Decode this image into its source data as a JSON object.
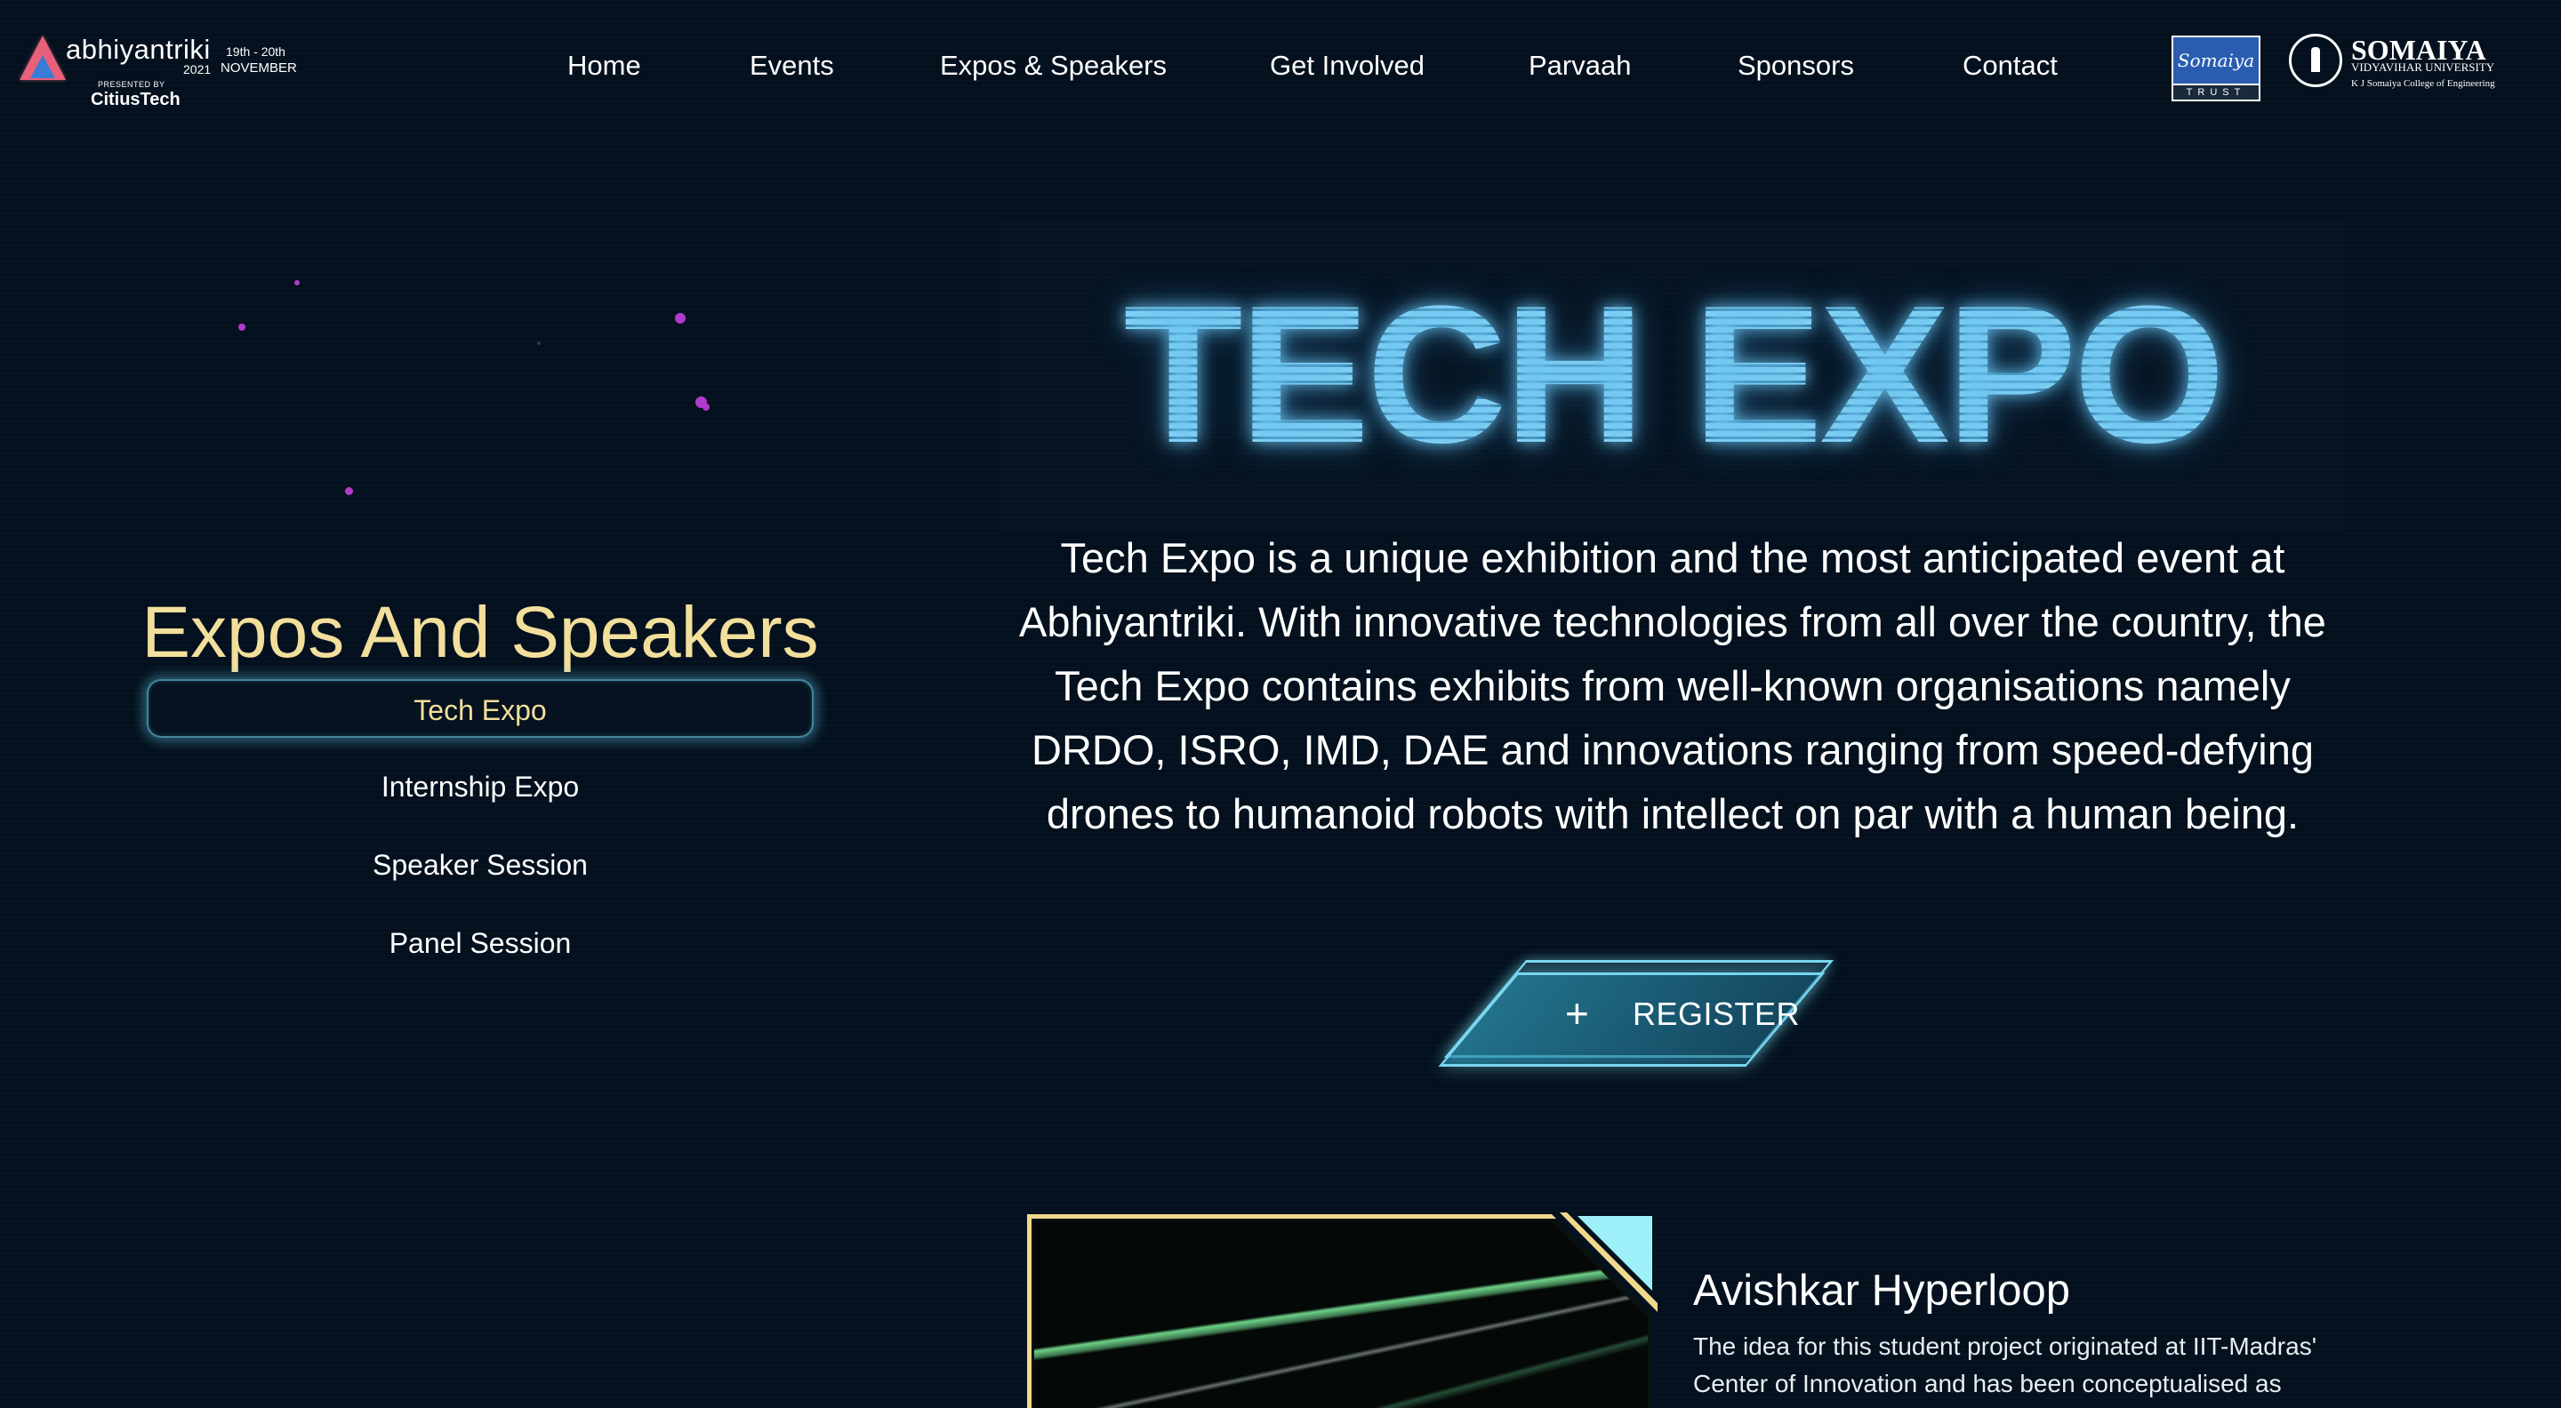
{
  "header": {
    "logo": {
      "name": "abhiyantriki",
      "year": "2021",
      "date_top": "19th - 20th",
      "date_bottom": "NOVEMBER",
      "presented_by": "PRESENTED BY",
      "sponsor": "CitiusTech"
    },
    "nav": [
      {
        "label": "Home"
      },
      {
        "label": "Events"
      },
      {
        "label": "Expos & Speakers"
      },
      {
        "label": "Get Involved"
      },
      {
        "label": "Parvaah"
      },
      {
        "label": "Sponsors"
      },
      {
        "label": "Contact"
      }
    ],
    "trust_logo": {
      "text": "Somaiya",
      "sub": "TRUST"
    },
    "university_logo": {
      "title": "SOMAIYA",
      "subtitle": "VIDYAVIHAR UNIVERSITY",
      "college": "K J Somaiya College of Engineering"
    }
  },
  "sidebar": {
    "title": "Expos And Speakers",
    "items": [
      {
        "label": "Tech Expo",
        "active": true
      },
      {
        "label": "Internship Expo",
        "active": false
      },
      {
        "label": "Speaker Session",
        "active": false
      },
      {
        "label": "Panel Session",
        "active": false
      }
    ]
  },
  "main": {
    "hero_title": "TECH EXPO",
    "description": "Tech Expo is a unique exhibition and the most anticipated event at Abhiyantriki. With innovative technologies from all over the country, the Tech Expo contains exhibits from well-known organisations namely DRDO, ISRO, IMD, DAE and innovations ranging from speed-defying drones to humanoid robots with intellect on par with a human being.",
    "register": {
      "icon": "plus-icon",
      "label": "REGISTER"
    }
  },
  "card": {
    "title": "Avishkar Hyperloop",
    "description": "The idea for this student project originated at IIT-Madras' Center of Innovation and has been conceptualised as"
  },
  "colors": {
    "background": "#04101d",
    "accent_gold": "#f2df9c",
    "accent_cyan": "#79d6ee",
    "particle": "#b03acb"
  }
}
